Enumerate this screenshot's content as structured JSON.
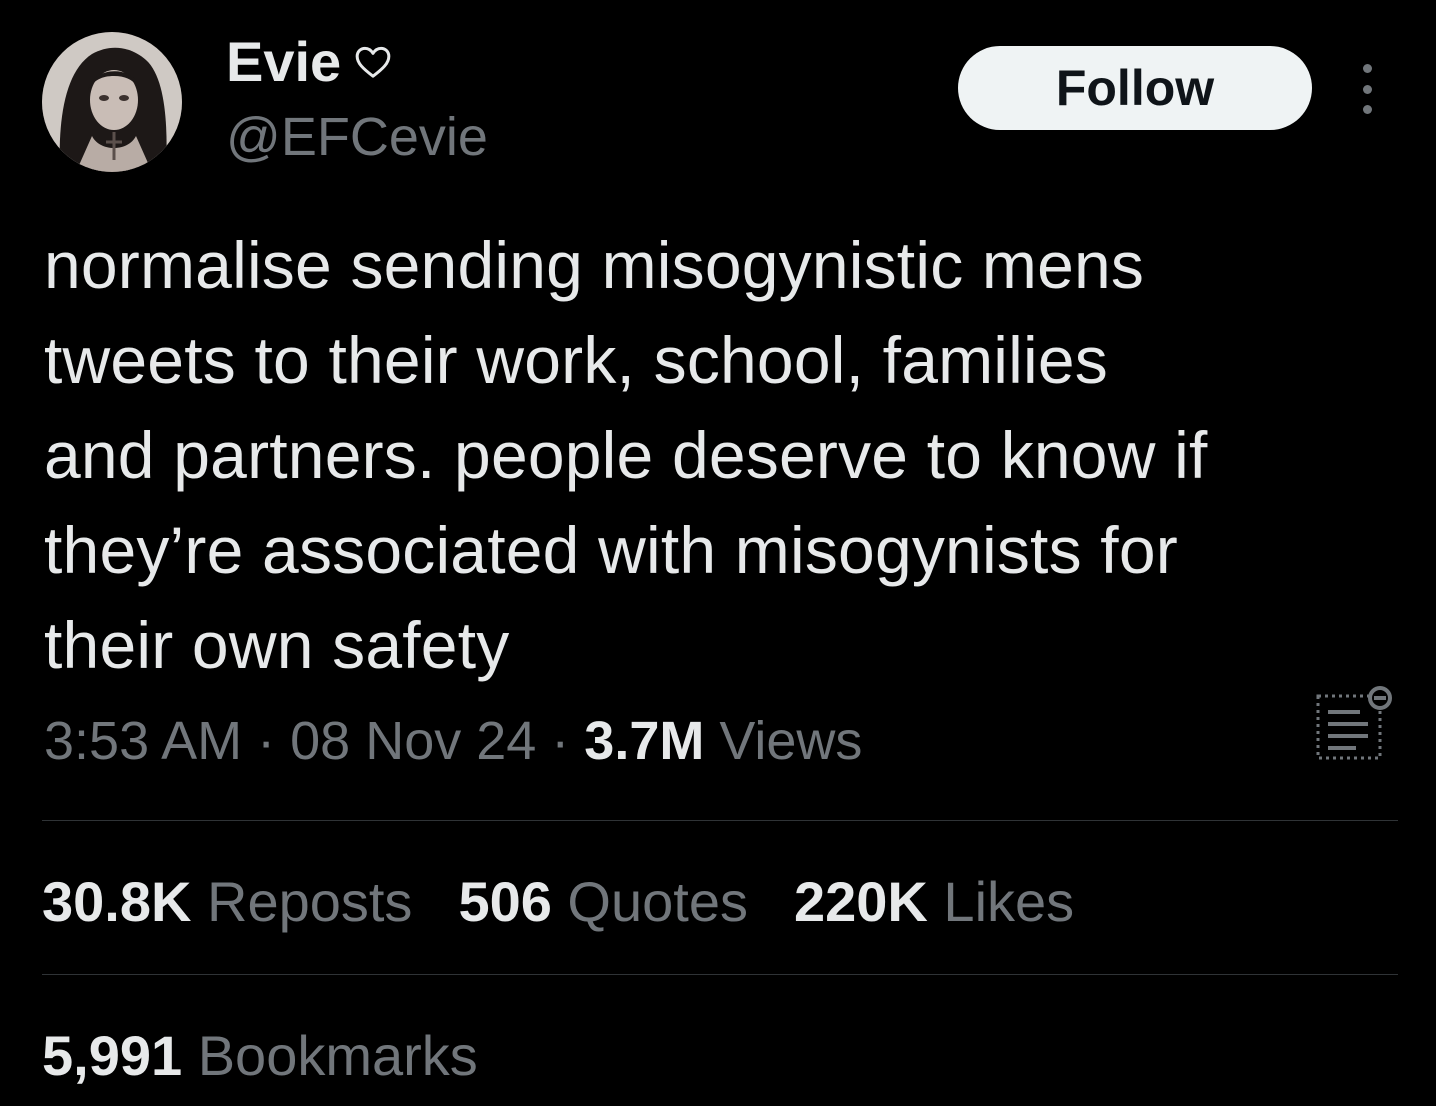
{
  "author": {
    "display_name": "Evie",
    "verified_icon": "heart-outline-icon",
    "handle": "@EFCevie"
  },
  "actions": {
    "follow_label": "Follow",
    "more_icon": "more-vertical-icon"
  },
  "tweet": {
    "text": "normalise sending misogynistic mens\ntweets to their work, school, families\nand partners. people deserve to know if\nthey’re associated with misogynists for\ntheir own safety",
    "time": "3:53 AM",
    "separator": " · ",
    "date": "08 Nov 24",
    "views_count": "3.7M",
    "views_label": " Views",
    "analytics_icon": "analytics-icon"
  },
  "stats": {
    "reposts": {
      "count": "30.8K",
      "label": " Reposts"
    },
    "quotes": {
      "count": "506",
      "label": " Quotes"
    },
    "likes": {
      "count": "220K",
      "label": " Likes"
    },
    "bookmarks": {
      "count": "5,991",
      "label": " Bookmarks"
    }
  },
  "colors": {
    "background": "#000000",
    "primary_text": "#e7e9ea",
    "secondary_text": "#71767b",
    "divider": "#2f3336",
    "follow_bg": "#eff3f4"
  }
}
